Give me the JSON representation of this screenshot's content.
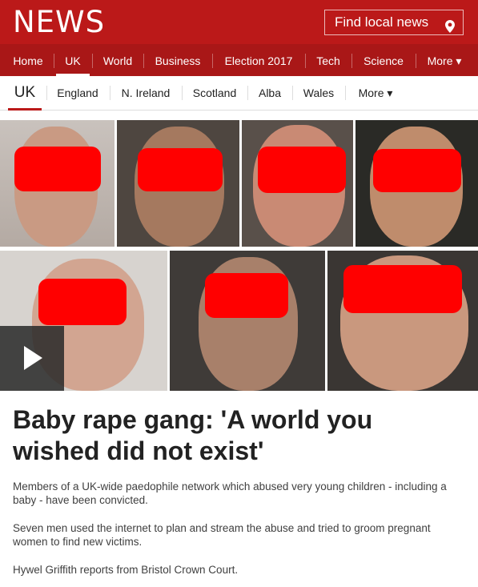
{
  "masthead": {
    "logo": "NEWS",
    "find_local": "Find local news",
    "pin_icon": "location-pin-icon",
    "bg": "#bb1919"
  },
  "nav": {
    "items": [
      "Home",
      "UK",
      "World",
      "Business",
      "Election 2017",
      "Tech",
      "Science",
      "More ▾"
    ],
    "active": "UK"
  },
  "subnav": {
    "items": [
      "UK",
      "England",
      "N. Ireland",
      "Scotland",
      "Alba",
      "Wales",
      "More ▾"
    ],
    "active": "UK"
  },
  "hero": {
    "play_icon": "play-icon",
    "photos_count": 7,
    "redaction_color": "#ff0000"
  },
  "article": {
    "headline": "Baby rape gang: 'A world you wished did not exist'",
    "paragraphs": [
      "Members of a UK-wide paedophile network which abused very young children - including a baby - have been convicted.",
      "Seven men used the internet to plan and stream the abuse and tried to groom pregnant women to find new victims.",
      "Hywel Griffith reports from Bristol Crown Court."
    ]
  }
}
